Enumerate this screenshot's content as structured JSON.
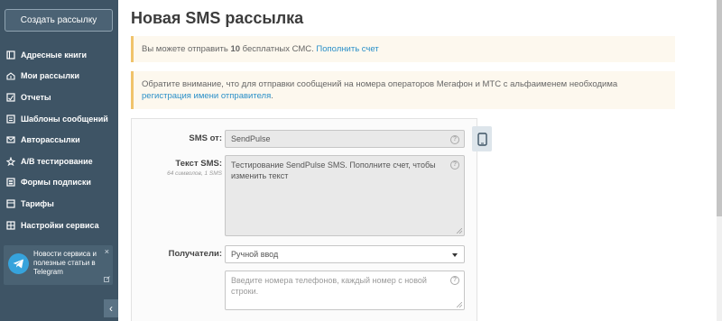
{
  "sidebar": {
    "create_button": "Создать рассылку",
    "items": [
      {
        "label": "Адресные книги",
        "icon": "book-icon"
      },
      {
        "label": "Мои рассылки",
        "icon": "mailbox-icon"
      },
      {
        "label": "Отчеты",
        "icon": "report-icon"
      },
      {
        "label": "Шаблоны сообщений",
        "icon": "template-icon"
      },
      {
        "label": "Авторассылки",
        "icon": "autosend-icon"
      },
      {
        "label": "A/B тестирование",
        "icon": "ab-test-icon"
      },
      {
        "label": "Формы подписки",
        "icon": "form-icon"
      },
      {
        "label": "Тарифы",
        "icon": "tariff-icon"
      },
      {
        "label": "Настройки сервиса",
        "icon": "settings-icon"
      }
    ],
    "telegram": {
      "text": "Новости сервиса и полезные статьи в Telegram",
      "close": "×"
    },
    "collapse": "‹"
  },
  "main": {
    "title": "Новая SMS рассылка",
    "notice1": {
      "prefix": "Вы можете отправить ",
      "count": "10",
      "suffix": " бесплатных СМС. ",
      "link": "Пополнить счет"
    },
    "notice2": {
      "text": "Обратите внимание, что для отправки сообщений на номера операторов Мегафон и МТС с альфаименем необходима ",
      "link": "регистрация имени отправителя",
      "end": "."
    },
    "form": {
      "sender_label": "SMS от:",
      "sender_value": "SendPulse",
      "text_label": "Текст SMS:",
      "text_meta": "64 символов, 1 SMS",
      "text_value": "Тестирование SendPulse SMS. Пополните счет, чтобы изменить текст",
      "recipients_label": "Получатели:",
      "recipients_value": "Ручной ввод",
      "phones_placeholder": "Введите номера телефонов, каждый номер с новой строки.",
      "help": "?"
    }
  },
  "colors": {
    "sidebar_bg": "#3e5465",
    "notice_border": "#f0c36b",
    "link": "#2a8fc8",
    "telegram": "#36a3dc"
  }
}
